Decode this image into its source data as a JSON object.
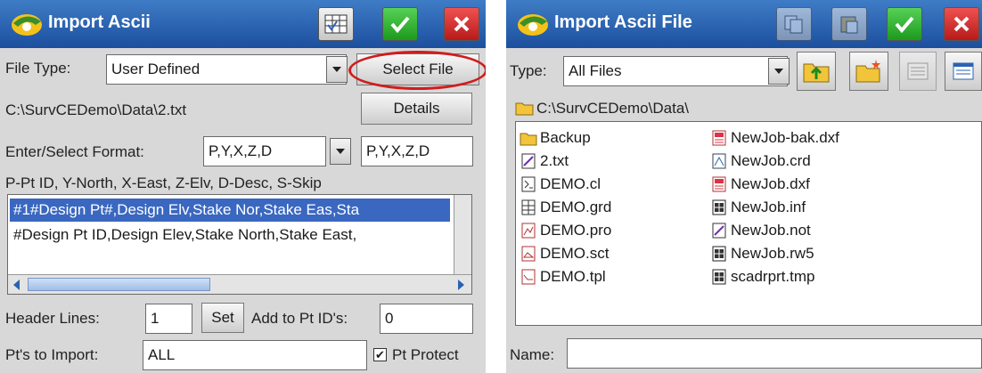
{
  "left": {
    "title": "Import Ascii",
    "file_type_label": "File Type:",
    "file_type_value": "User Defined",
    "select_file_label": "Select File",
    "file_path": "C:\\SurvCEDemo\\Data\\2.txt",
    "details_label": "Details",
    "format_label": "Enter/Select Format:",
    "format_select_value": "P,Y,X,Z,D",
    "format_text_value": "P,Y,X,Z,D",
    "format_legend": "P-Pt ID, Y-North, X-East, Z-Elv, D-Desc, S-Skip",
    "format_list": [
      "#1#Design Pt#,Design Elv,Stake Nor,Stake Eas,Sta",
      "#Design Pt ID,Design Elev,Stake North,Stake East,"
    ],
    "header_lines_label": "Header Lines:",
    "header_lines_value": "1",
    "set_label": "Set",
    "add_to_pt_label": "Add to Pt ID's:",
    "add_to_pt_value": "0",
    "pts_to_import_label": "Pt's to Import:",
    "pts_to_import_value": "ALL",
    "pt_protect_label": "Pt Protect",
    "pt_protect_checked": true
  },
  "right": {
    "title": "Import Ascii File",
    "type_label": "Type:",
    "type_value": "All Files",
    "current_path": "C:\\SurvCEDemo\\Data\\",
    "files_col1": [
      {
        "name": "Backup",
        "icon": "folder-icon"
      },
      {
        "name": "2.txt",
        "icon": "text-file-icon"
      },
      {
        "name": "DEMO.cl",
        "icon": "cl-file-icon"
      },
      {
        "name": "DEMO.grd",
        "icon": "grid-file-icon"
      },
      {
        "name": "DEMO.pro",
        "icon": "profile-file-icon"
      },
      {
        "name": "DEMO.sct",
        "icon": "section-file-icon"
      },
      {
        "name": "DEMO.tpl",
        "icon": "template-file-icon"
      }
    ],
    "files_col2": [
      {
        "name": "NewJob-bak.dxf",
        "icon": "dxf-file-icon"
      },
      {
        "name": "NewJob.crd",
        "icon": "crd-file-icon"
      },
      {
        "name": "NewJob.dxf",
        "icon": "dxf-file-icon"
      },
      {
        "name": "NewJob.inf",
        "icon": "table-file-icon"
      },
      {
        "name": "NewJob.not",
        "icon": "note-file-icon"
      },
      {
        "name": "NewJob.rw5",
        "icon": "table-file-icon"
      },
      {
        "name": "scadrprt.tmp",
        "icon": "table-file-icon"
      }
    ],
    "name_label": "Name:",
    "name_value": ""
  },
  "colors": {
    "title_bar": "#2a62b3",
    "ok_green": "#2fb42f",
    "close_red": "#d32a2a",
    "highlight_oval": "#cf1d1d",
    "selection": "#3a67c0"
  }
}
